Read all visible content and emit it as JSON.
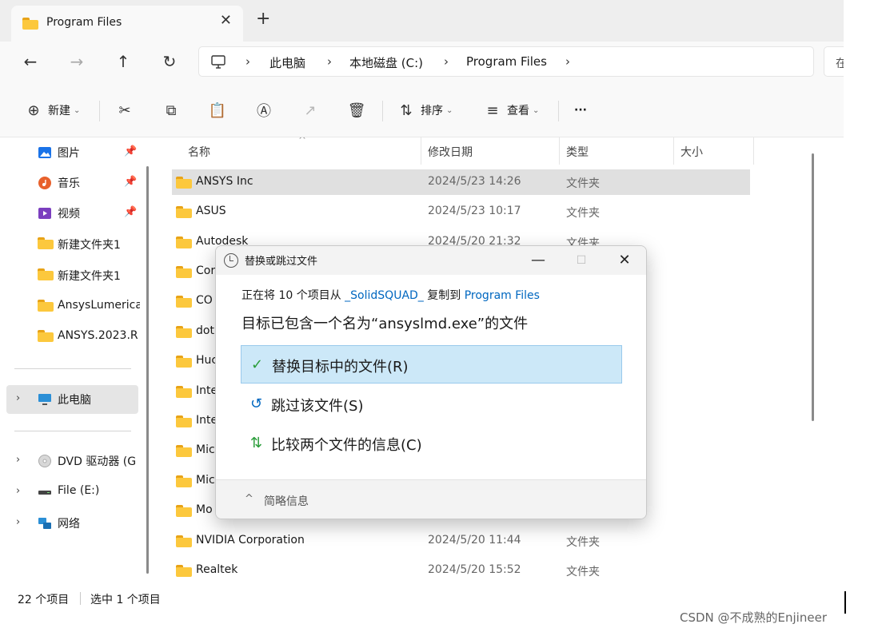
{
  "tab": {
    "title": "Program Files",
    "close": "✕",
    "add": "+"
  },
  "nav": {
    "back": "←",
    "forward": "→",
    "up": "↑",
    "refresh": "↻"
  },
  "breadcrumbs": [
    "此电脑",
    "本地磁盘 (C:)",
    "Program Files"
  ],
  "search_stub": "在",
  "toolbar": {
    "new_label": "新建",
    "sort_label": "排序",
    "view_label": "查看",
    "more_label": "···"
  },
  "sidebar": {
    "items": [
      {
        "label": "图片",
        "icon": "pictures-icon",
        "pinned": true
      },
      {
        "label": "音乐",
        "icon": "music-icon",
        "pinned": true
      },
      {
        "label": "视频",
        "icon": "videos-icon",
        "pinned": true
      },
      {
        "label": "新建文件夹1",
        "icon": "folder-icon"
      },
      {
        "label": "新建文件夹1",
        "icon": "folder-icon"
      },
      {
        "label": "AnsysLumerica",
        "icon": "folder-icon"
      },
      {
        "label": "ANSYS.2023.R",
        "icon": "folder-icon"
      },
      {
        "label": "此电脑",
        "icon": "pc-icon",
        "selected": true
      },
      {
        "label": "DVD 驱动器 (G",
        "icon": "dvd-icon"
      },
      {
        "label": "File (E:)",
        "icon": "drive-icon"
      },
      {
        "label": "网络",
        "icon": "network-icon"
      }
    ]
  },
  "columns": {
    "name": "名称",
    "date": "修改日期",
    "type": "类型",
    "size": "大小"
  },
  "files": [
    {
      "name": "ANSYS Inc",
      "date": "2024/5/23 14:26",
      "type": "文件夹"
    },
    {
      "name": "ASUS",
      "date": "2024/5/23 10:17",
      "type": "文件夹"
    },
    {
      "name": "Autodesk",
      "date": "2024/5/20 21:32",
      "type": "文件夹"
    },
    {
      "name": "Cor",
      "date": "",
      "type": ""
    },
    {
      "name": "CO",
      "date": "",
      "type": ""
    },
    {
      "name": "dot",
      "date": "",
      "type": ""
    },
    {
      "name": "Huc",
      "date": "",
      "type": ""
    },
    {
      "name": "Inte",
      "date": "",
      "type": ""
    },
    {
      "name": "Inte",
      "date": "",
      "type": ""
    },
    {
      "name": "Mic",
      "date": "",
      "type": ""
    },
    {
      "name": "Mic",
      "date": "",
      "type": ""
    },
    {
      "name": "Mo",
      "date": "",
      "type": ""
    },
    {
      "name": "NVIDIA Corporation",
      "date": "2024/5/20 11:44",
      "type": "文件夹"
    },
    {
      "name": "Realtek",
      "date": "2024/5/20 15:52",
      "type": "文件夹"
    }
  ],
  "status": {
    "count": "22 个项目",
    "selected": "选中 1 个项目"
  },
  "dialog": {
    "title": "替换或跳过文件",
    "minimize": "—",
    "maximize": "☐",
    "close": "✕",
    "line1_prefix": "正在将 10 个项目从 ",
    "source": "_SolidSQUAD_",
    "line1_middle": " 复制到 ",
    "destination": "Program Files",
    "line2": "目标已包含一个名为“ansyslmd.exe”的文件",
    "options": [
      {
        "icon": "✓",
        "label": "替换目标中的文件(R)"
      },
      {
        "icon": "↺",
        "label": "跳过该文件(S)"
      },
      {
        "icon": "⇅",
        "label": "比较两个文件的信息(C)"
      }
    ],
    "footer_label": "简略信息",
    "footer_caret": "^"
  },
  "watermark": "CSDN @不成熟的Enjineer",
  "colors": {
    "accent": "#0067c0",
    "highlight": "#cce8f8",
    "folder": "#fcc83d"
  }
}
